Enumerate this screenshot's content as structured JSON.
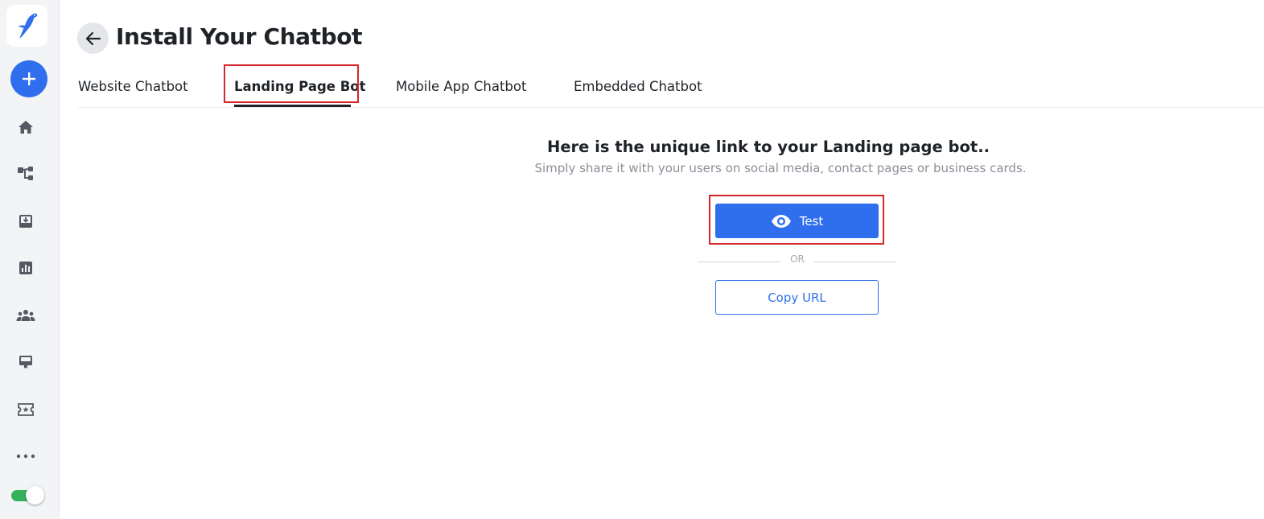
{
  "app": {
    "title": "Install Your Chatbot"
  },
  "sidebar": {
    "items": [
      {
        "icon": "home-icon"
      },
      {
        "icon": "flow-icon"
      },
      {
        "icon": "inbox-icon"
      },
      {
        "icon": "analytics-icon"
      },
      {
        "icon": "team-icon"
      },
      {
        "icon": "billing-icon"
      },
      {
        "icon": "ticket-icon"
      },
      {
        "icon": "more-icon"
      }
    ],
    "toggle_on": true
  },
  "tabs": [
    {
      "label": "Website Chatbot",
      "active": false
    },
    {
      "label": "Landing Page Bot",
      "active": true
    },
    {
      "label": "Mobile App Chatbot",
      "active": false
    },
    {
      "label": "Embedded Chatbot",
      "active": false
    }
  ],
  "main": {
    "headline": "Here is the unique link to your Landing page bot..",
    "subtext": "Simply share it with your users on social media, contact pages or business cards.",
    "test_label": "Test",
    "or_label": "OR",
    "copy_label": "Copy URL"
  },
  "colors": {
    "accent": "#2f6fed",
    "highlight": "#d4262b",
    "toggle": "#34b35a"
  }
}
